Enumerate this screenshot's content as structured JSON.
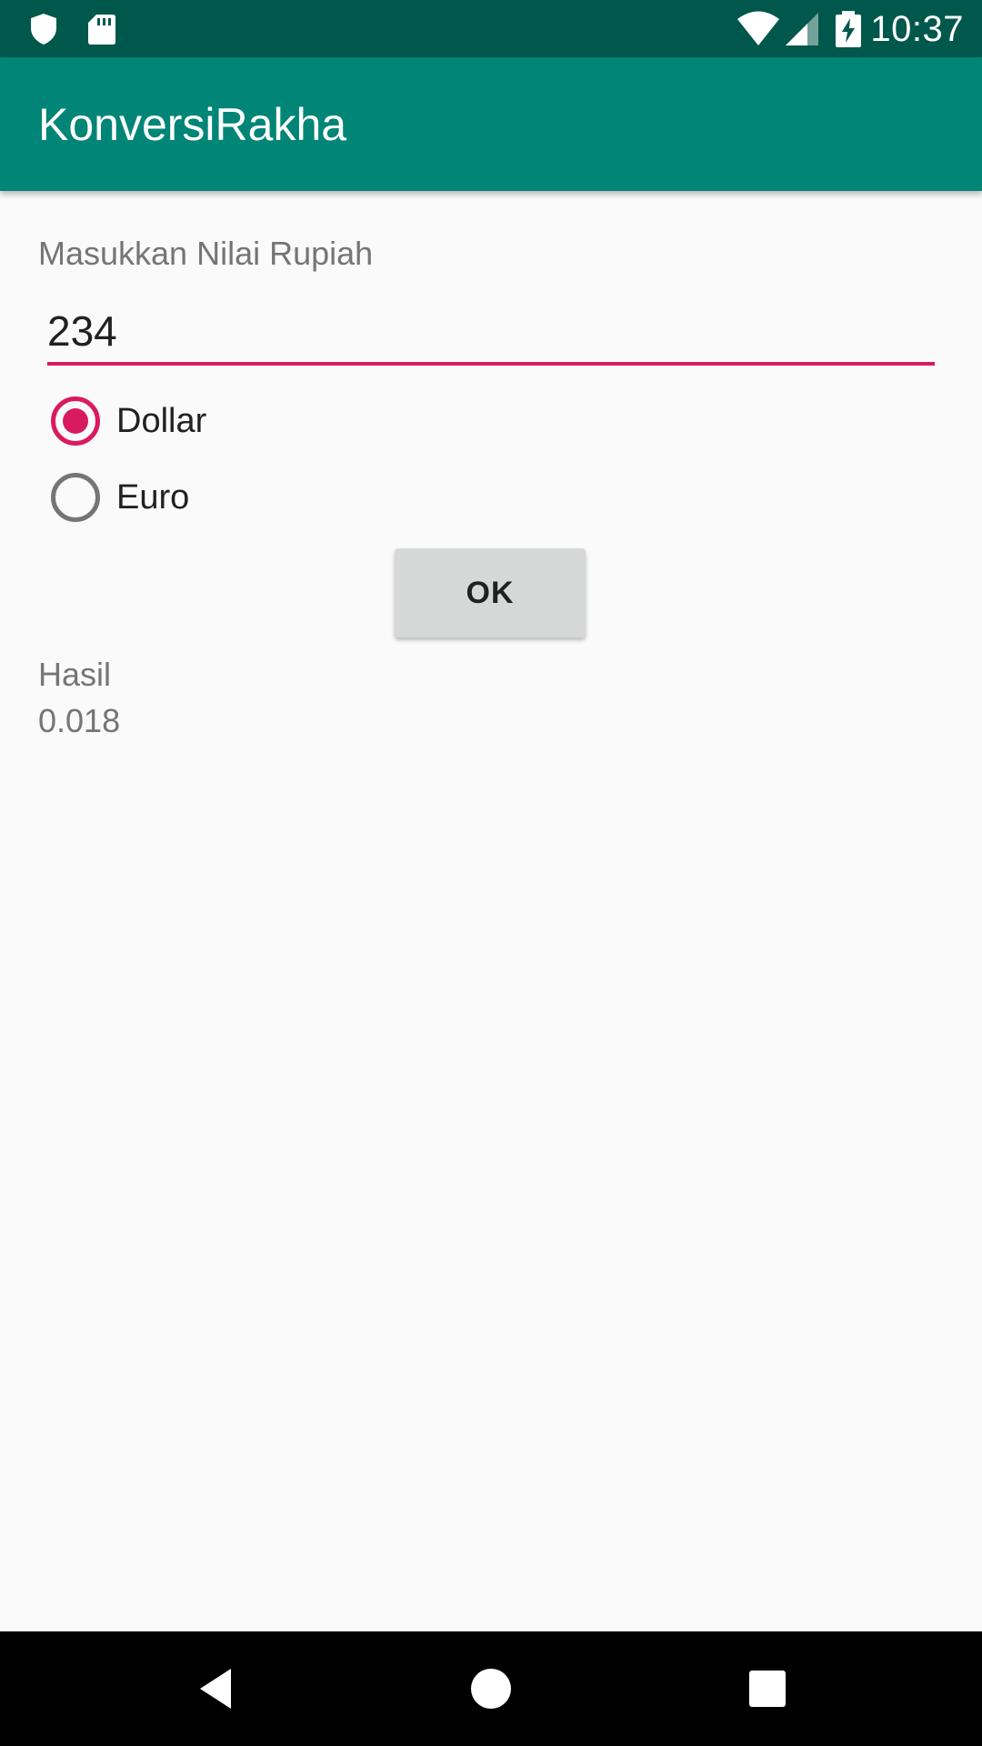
{
  "status_bar": {
    "time": "10:37",
    "left_icons": [
      "shield-icon",
      "sd-card-icon"
    ],
    "right_icons": [
      "wifi-icon",
      "cell-signal-icon",
      "battery-charging-icon"
    ],
    "background": "#00574b"
  },
  "app_bar": {
    "title": "KonversiRakha",
    "background": "#008577"
  },
  "form": {
    "input_label": "Masukkan Nilai Rupiah",
    "input_value": "234",
    "accent_color": "#d81b60",
    "options": [
      {
        "label": "Dollar",
        "selected": true
      },
      {
        "label": "Euro",
        "selected": false
      }
    ],
    "submit_label": "OK"
  },
  "result": {
    "label": "Hasil",
    "value": "0.018"
  },
  "nav_bar": {
    "buttons": [
      "back-icon",
      "home-icon",
      "recents-icon"
    ]
  }
}
